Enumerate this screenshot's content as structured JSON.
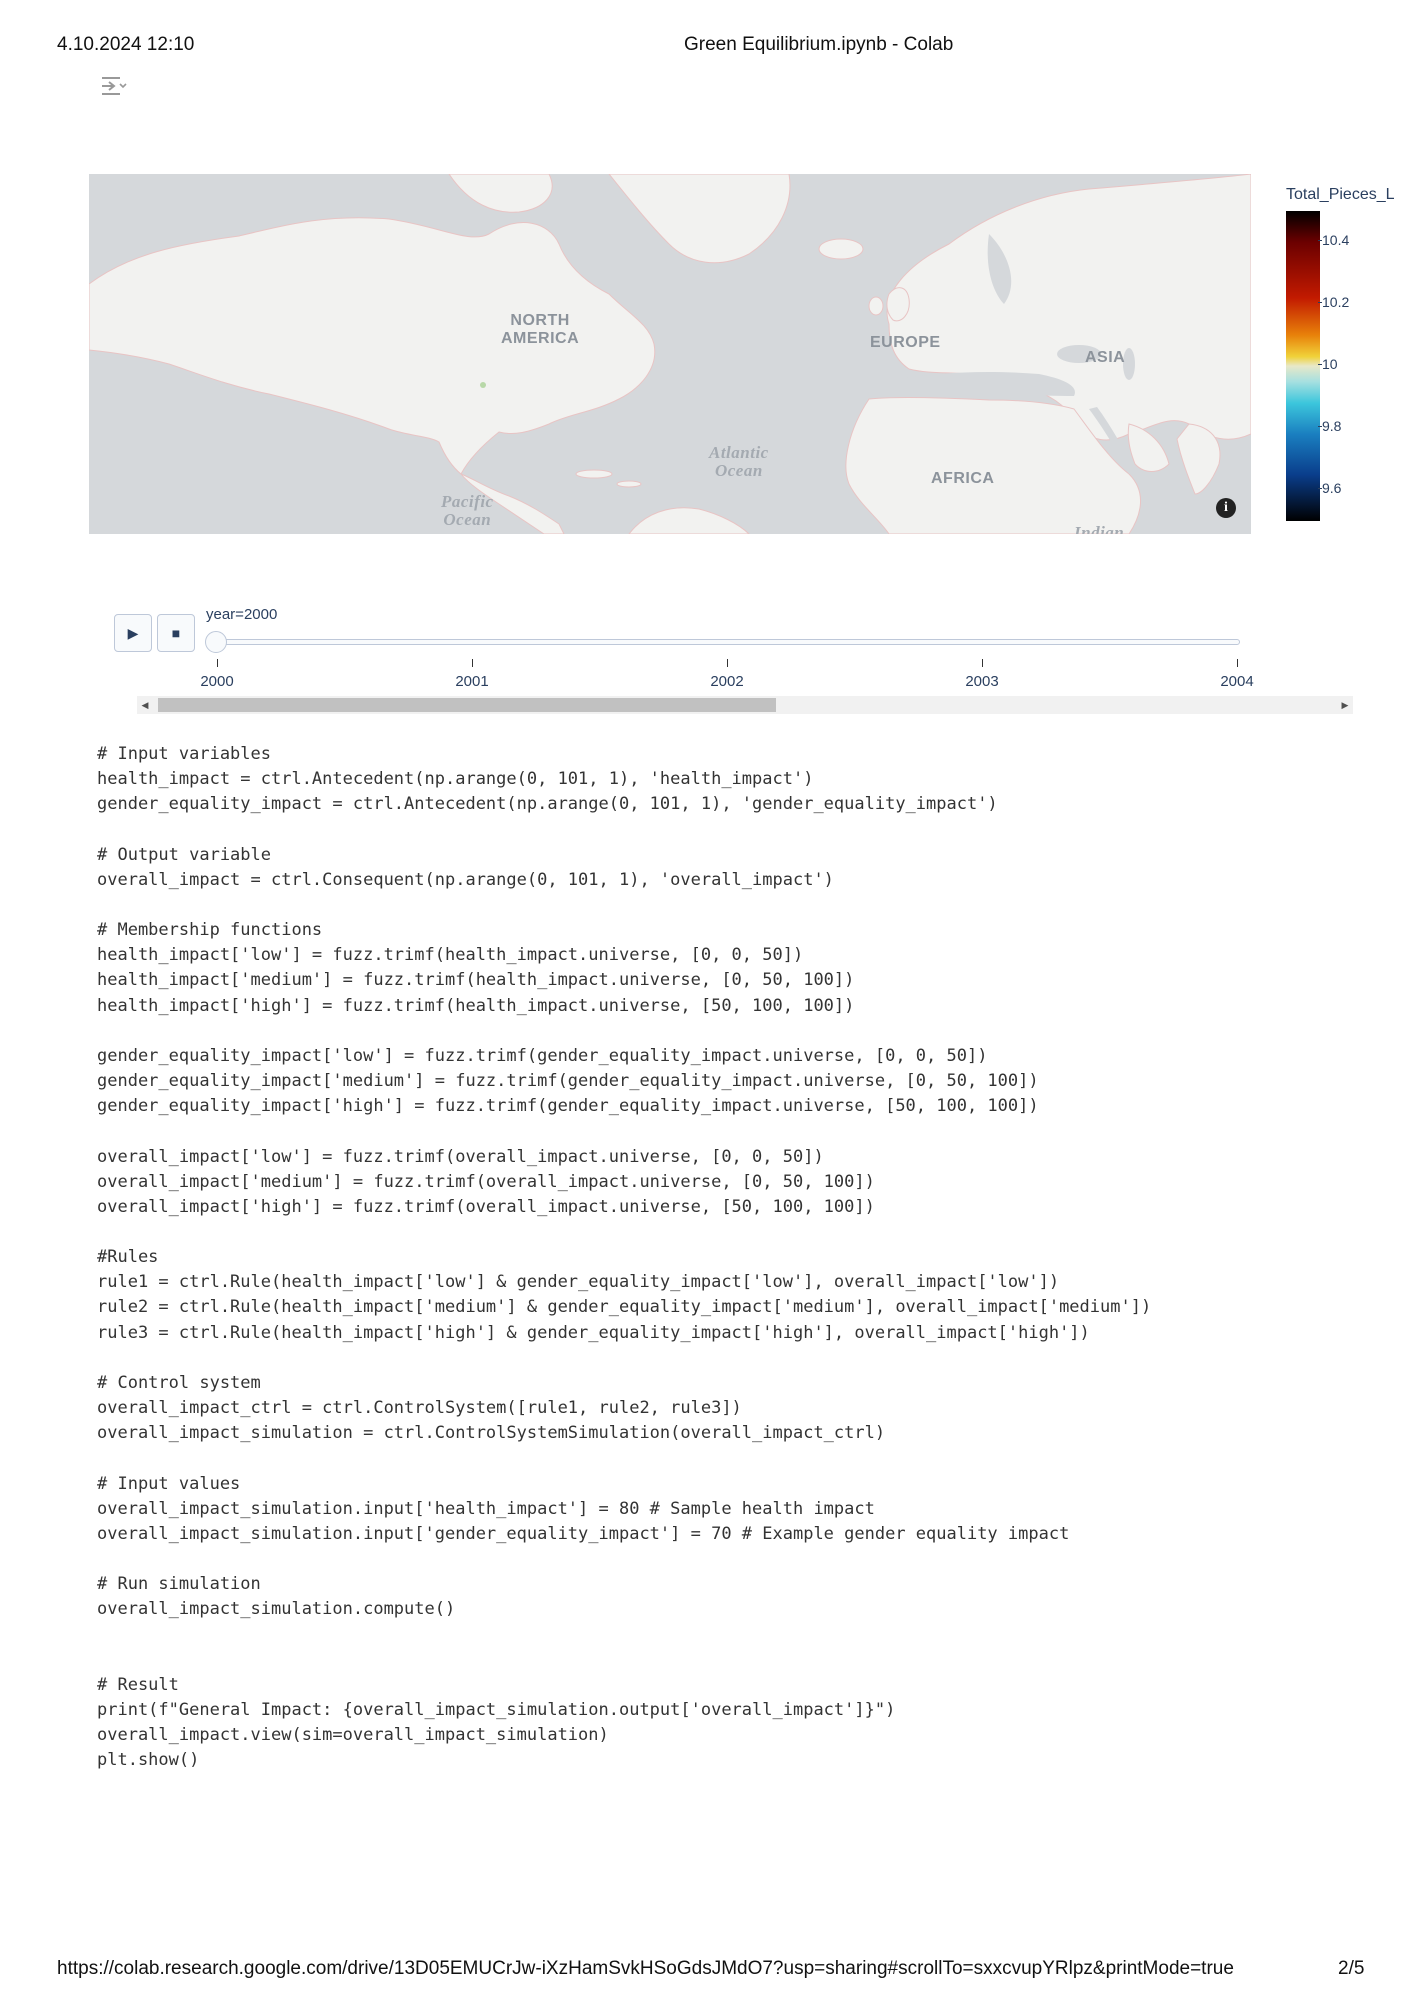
{
  "header": {
    "datetime": "4.10.2024 12:10",
    "title": "Green Equilibrium.ipynb - Colab"
  },
  "footer": {
    "url": "https://colab.research.google.com/drive/13D05EMUCrJw-iXzHamSvkHSoGdsJMdO7?usp=sharing#scrollTo=sxxcvupYRlpz&printMode=true",
    "page": "2/5"
  },
  "cell_output_icon": "output-toggle-icon",
  "map": {
    "labels": {
      "north_america": "NORTH\nAMERICA",
      "europe": "EUROPE",
      "asia": "ASIA",
      "africa": "AFRICA",
      "atlantic": "Atlantic\nOcean",
      "pacific": "Pacific\nOcean",
      "indian": "Indian"
    },
    "info_icon": "info-icon",
    "colors": {
      "land": "#f2f2f0",
      "water": "#d5d8db",
      "borders": "#e8c4c4"
    }
  },
  "colorbar": {
    "title": "Total_Pieces_L",
    "ticks": [
      "10.4",
      "10.2",
      "10",
      "9.8",
      "9.6"
    ],
    "colorscale": "thermal diverging (black-red-yellow-cyan-blue-black)"
  },
  "animation": {
    "play_icon": "play-icon",
    "stop_icon": "stop-icon",
    "current_label": "year=2000",
    "steps": [
      "2000",
      "2001",
      "2002",
      "2003",
      "2004"
    ],
    "current_index": 0
  },
  "code": "# Input variables\nhealth_impact = ctrl.Antecedent(np.arange(0, 101, 1), 'health_impact')\ngender_equality_impact = ctrl.Antecedent(np.arange(0, 101, 1), 'gender_equality_impact')\n\n# Output variable\noverall_impact = ctrl.Consequent(np.arange(0, 101, 1), 'overall_impact')\n\n# Membership functions\nhealth_impact['low'] = fuzz.trimf(health_impact.universe, [0, 0, 50])\nhealth_impact['medium'] = fuzz.trimf(health_impact.universe, [0, 50, 100])\nhealth_impact['high'] = fuzz.trimf(health_impact.universe, [50, 100, 100])\n\ngender_equality_impact['low'] = fuzz.trimf(gender_equality_impact.universe, [0, 0, 50])\ngender_equality_impact['medium'] = fuzz.trimf(gender_equality_impact.universe, [0, 50, 100])\ngender_equality_impact['high'] = fuzz.trimf(gender_equality_impact.universe, [50, 100, 100])\n\noverall_impact['low'] = fuzz.trimf(overall_impact.universe, [0, 0, 50])\noverall_impact['medium'] = fuzz.trimf(overall_impact.universe, [0, 50, 100])\noverall_impact['high'] = fuzz.trimf(overall_impact.universe, [50, 100, 100])\n\n#Rules\nrule1 = ctrl.Rule(health_impact['low'] & gender_equality_impact['low'], overall_impact['low'])\nrule2 = ctrl.Rule(health_impact['medium'] & gender_equality_impact['medium'], overall_impact['medium'])\nrule3 = ctrl.Rule(health_impact['high'] & gender_equality_impact['high'], overall_impact['high'])\n\n# Control system\noverall_impact_ctrl = ctrl.ControlSystem([rule1, rule2, rule3])\noverall_impact_simulation = ctrl.ControlSystemSimulation(overall_impact_ctrl)\n\n# Input values\noverall_impact_simulation.input['health_impact'] = 80 # Sample health impact\noverall_impact_simulation.input['gender_equality_impact'] = 70 # Example gender equality impact\n\n# Run simulation\noverall_impact_simulation.compute()\n\n\n# Result\nprint(f\"General Impact: {overall_impact_simulation.output['overall_impact']}\")\noverall_impact.view(sim=overall_impact_simulation)\nplt.show()"
}
